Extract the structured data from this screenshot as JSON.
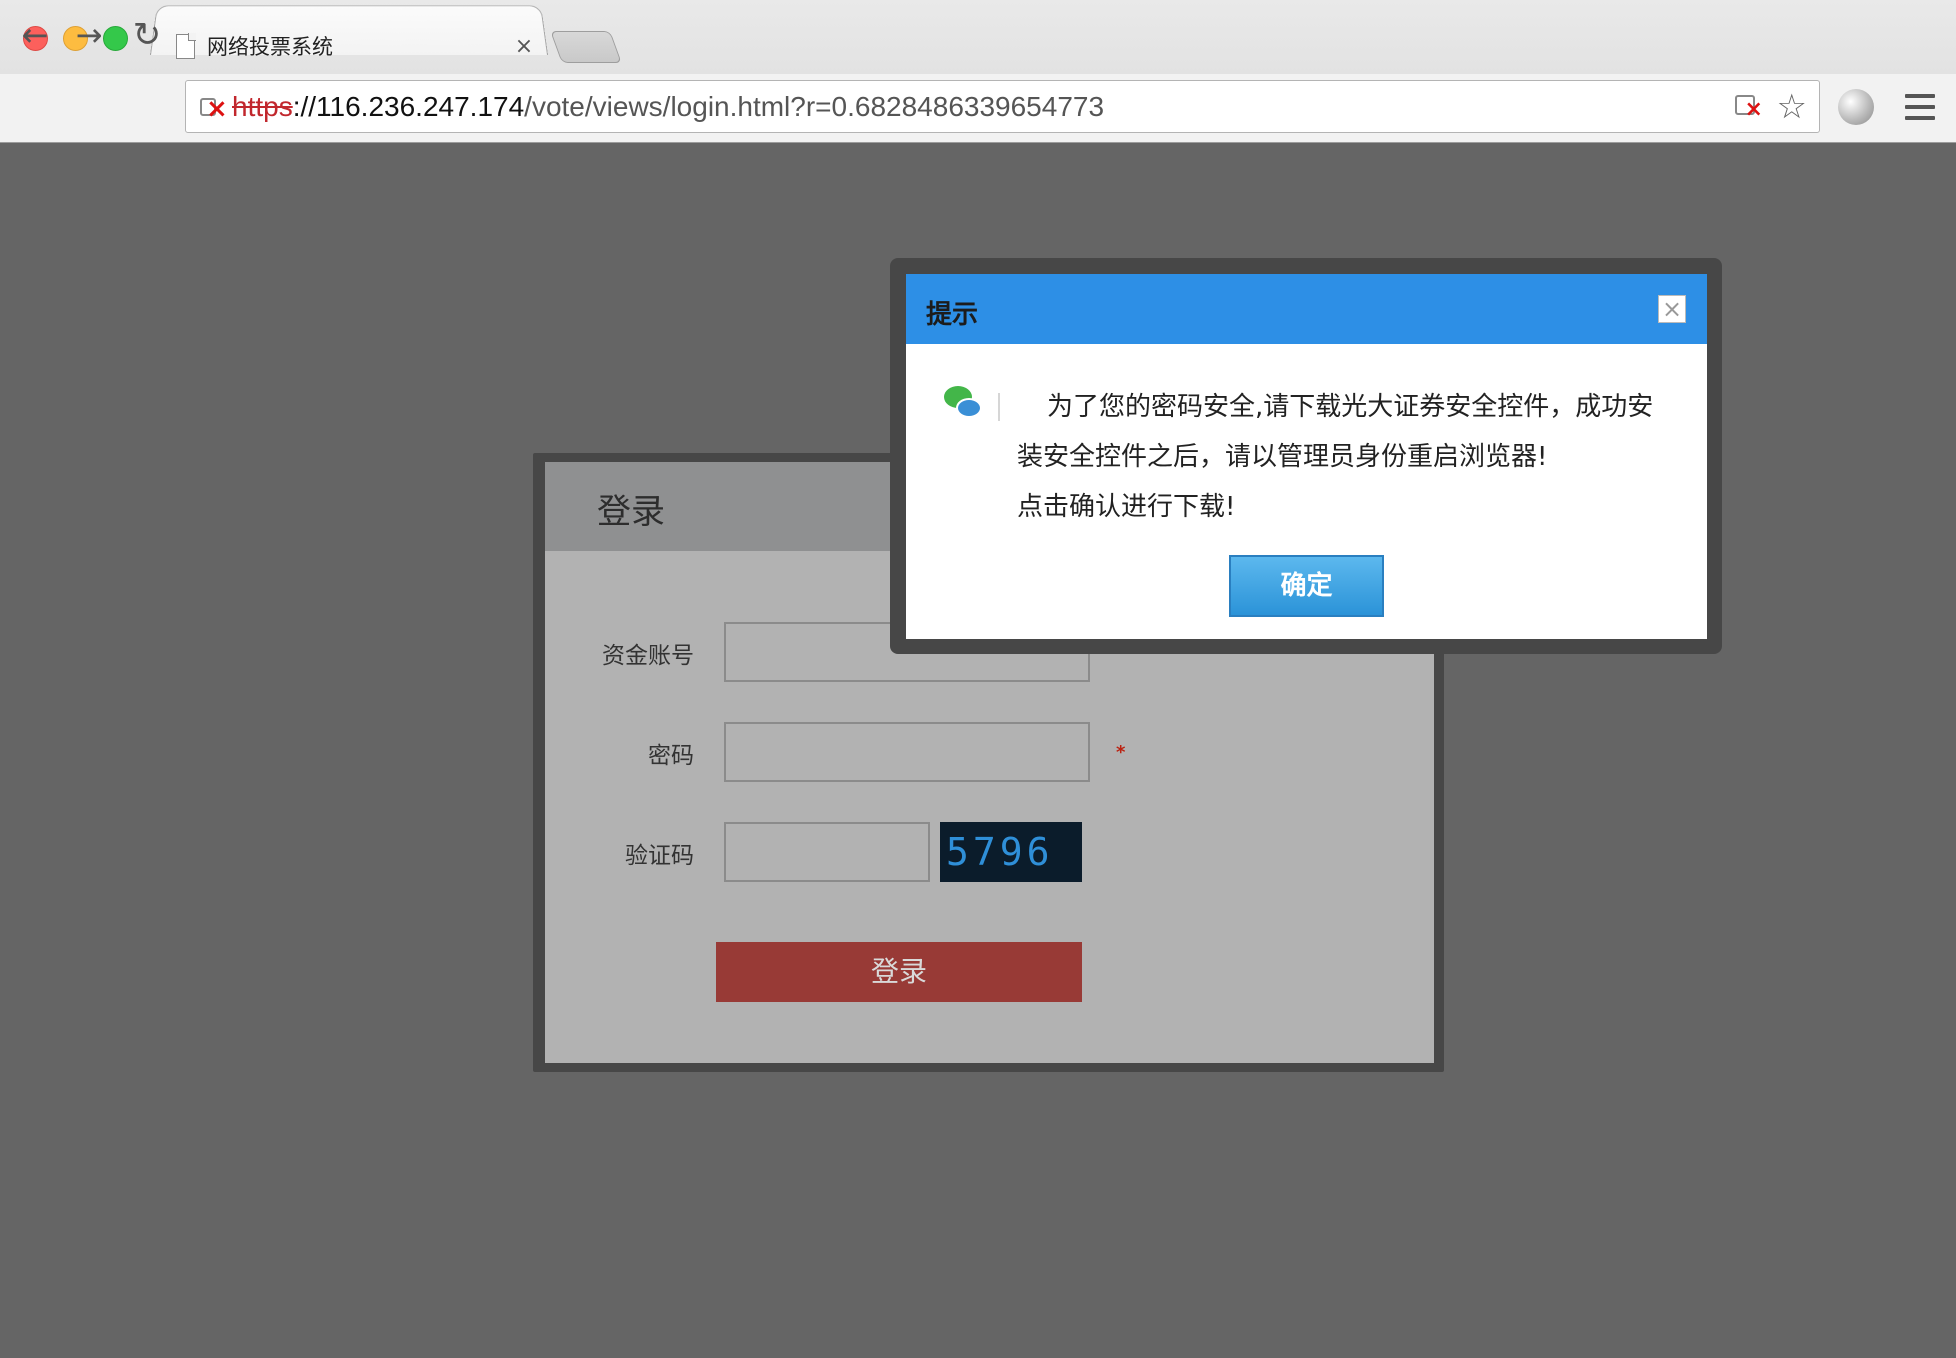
{
  "browser": {
    "tab_title": "网络投票系统",
    "tab_close": "×",
    "url": {
      "scheme": "https",
      "host": "://116.236.247.174",
      "path": "/vote/views/login.html?r=0.6828486339654773"
    }
  },
  "login": {
    "title": "登录",
    "fields": {
      "account_label": "资金账号",
      "password_label": "密码",
      "captcha_label": "验证码",
      "required_mark": "*"
    },
    "captcha_text": "5796",
    "submit_label": "登录"
  },
  "dialog": {
    "title": "提示",
    "close": "×",
    "message_line1": "为了您的密码安全,请下载光大证券安全控件，成功安装安全控件之后，请以管理员身份重启浏览器!",
    "message_line2": "点击确认进行下载!",
    "confirm_label": "确定"
  },
  "colors": {
    "dialog_header": "#2d8fe6",
    "login_button": "#983a36",
    "overlay": "#656565"
  }
}
